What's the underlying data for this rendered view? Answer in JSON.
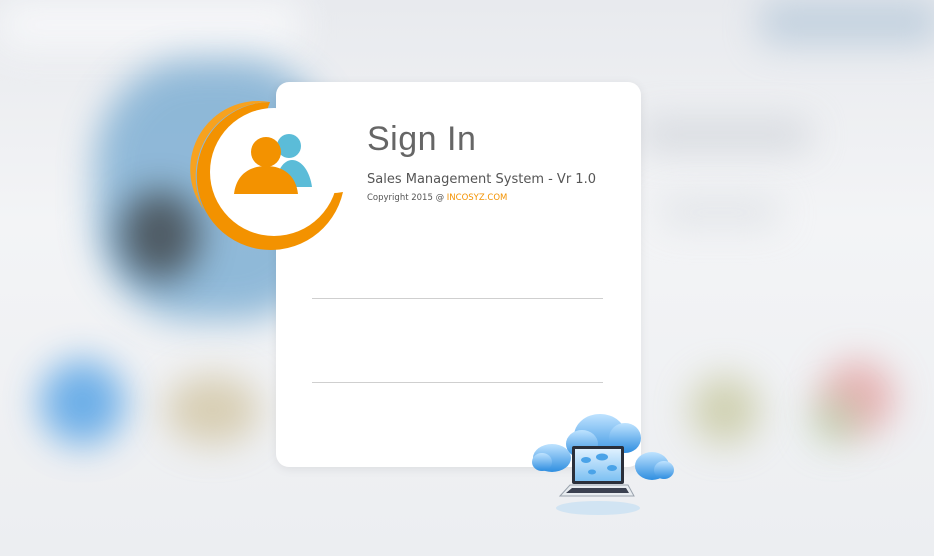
{
  "login": {
    "title": "Sign In",
    "subtitle": "Sales Management System - Vr 1.0",
    "copyright_prefix": "Copyright 2015 @ ",
    "company": "INCOSYZ.COM",
    "username_value": "",
    "password_value": ""
  },
  "icons": {
    "avatar": "user-group-icon",
    "illustration": "cloud-laptop-icon"
  },
  "colors": {
    "accent": "#f39200",
    "secondary": "#5bbcd8",
    "card": "#ffffff"
  }
}
